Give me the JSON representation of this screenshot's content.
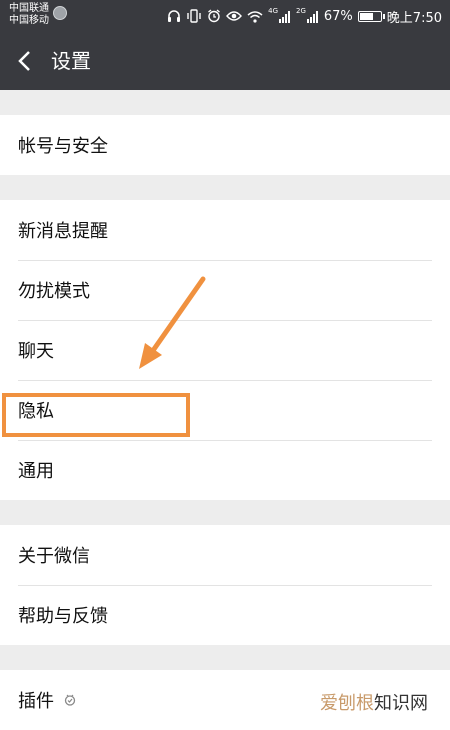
{
  "status_bar": {
    "carrier_1": "中国联通",
    "carrier_2": "中国移动",
    "battery_percent": "67%",
    "battery_level": 0.67,
    "time": "晚上7:50",
    "network_1": "4G",
    "network_2": "2G",
    "icons": [
      "headset-icon",
      "vibrate-icon",
      "alarm-icon",
      "eye-icon",
      "wifi-icon",
      "signal-icon",
      "signal-icon",
      "battery-icon"
    ]
  },
  "header": {
    "title": "设置",
    "back_icon": "chevron-left-icon"
  },
  "groups": [
    {
      "items": [
        {
          "label": "帐号与安全"
        }
      ]
    },
    {
      "items": [
        {
          "label": "新消息提醒"
        },
        {
          "label": "勿扰模式"
        },
        {
          "label": "聊天"
        },
        {
          "label": "隐私"
        },
        {
          "label": "通用"
        }
      ]
    },
    {
      "items": [
        {
          "label": "关于微信"
        },
        {
          "label": "帮助与反馈"
        }
      ]
    },
    {
      "items": [
        {
          "label": "插件",
          "icon": "plugin-icon"
        }
      ]
    }
  ],
  "annotation": {
    "color": "#f0913f",
    "highlighted_item": "隐私"
  },
  "watermark": {
    "part1": "爱刨根",
    "part2": "知识网"
  },
  "colors": {
    "title_bar": "#393a3f",
    "background": "#ededed",
    "row_background": "#ffffff",
    "annotation": "#f0913f"
  }
}
